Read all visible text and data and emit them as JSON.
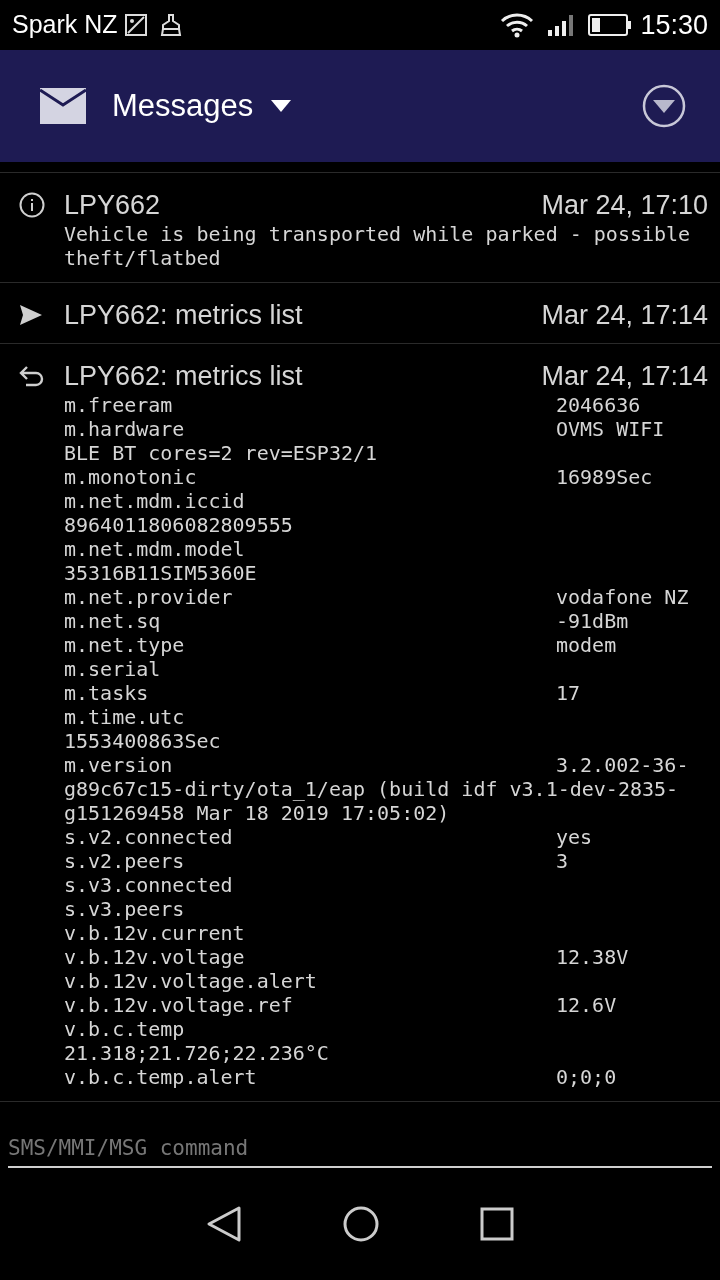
{
  "status_bar": {
    "carrier": "Spark NZ",
    "time": "15:30"
  },
  "app_bar": {
    "title": "Messages"
  },
  "messages": [
    {
      "kind": "alert",
      "title": "LPY662",
      "time": "Mar 24, 17:10",
      "body": "Vehicle is being transported while parked - possible theft/flatbed"
    },
    {
      "kind": "sent",
      "title": "LPY662: metrics list",
      "time": "Mar 24, 17:14"
    },
    {
      "kind": "reply",
      "title": "LPY662: metrics list",
      "time": "Mar 24, 17:14",
      "lines": [
        {
          "name": "m.freeram",
          "value": "2046636"
        },
        {
          "name": "m.hardware",
          "value": "OVMS WIFI"
        },
        {
          "name": "BLE BT cores=2 rev=ESP32/1"
        },
        {
          "name": "m.monotonic",
          "value": "16989Sec"
        },
        {
          "name": "m.net.mdm.iccid"
        },
        {
          "name": "8964011806082809555"
        },
        {
          "name": "m.net.mdm.model"
        },
        {
          "name": "35316B11SIM5360E"
        },
        {
          "name": "m.net.provider",
          "value": "vodafone NZ"
        },
        {
          "name": "m.net.sq",
          "value": "-91dBm"
        },
        {
          "name": "m.net.type",
          "value": "modem"
        },
        {
          "name": "m.serial"
        },
        {
          "name": "m.tasks",
          "value": "17"
        },
        {
          "name": "m.time.utc"
        },
        {
          "name": "1553400863Sec"
        },
        {
          "name": "m.version",
          "value": "3.2.002-36-"
        },
        {
          "name": "g89c67c15-dirty/ota_1/eap (build idf v3.1-dev-2835-"
        },
        {
          "name": "g151269458 Mar 18 2019 17:05:02)"
        },
        {
          "name": "s.v2.connected",
          "value": "yes"
        },
        {
          "name": "s.v2.peers",
          "value": "3"
        },
        {
          "name": "s.v3.connected"
        },
        {
          "name": "s.v3.peers"
        },
        {
          "name": "v.b.12v.current"
        },
        {
          "name": "v.b.12v.voltage",
          "value": "12.38V"
        },
        {
          "name": "v.b.12v.voltage.alert"
        },
        {
          "name": "v.b.12v.voltage.ref",
          "value": "12.6V"
        },
        {
          "name": "v.b.c.temp"
        },
        {
          "name": "21.318;21.726;22.236°C"
        },
        {
          "name": "v.b.c.temp.alert",
          "value": "0;0;0"
        }
      ]
    }
  ],
  "command_field": {
    "placeholder": "SMS/MMI/MSG command"
  }
}
